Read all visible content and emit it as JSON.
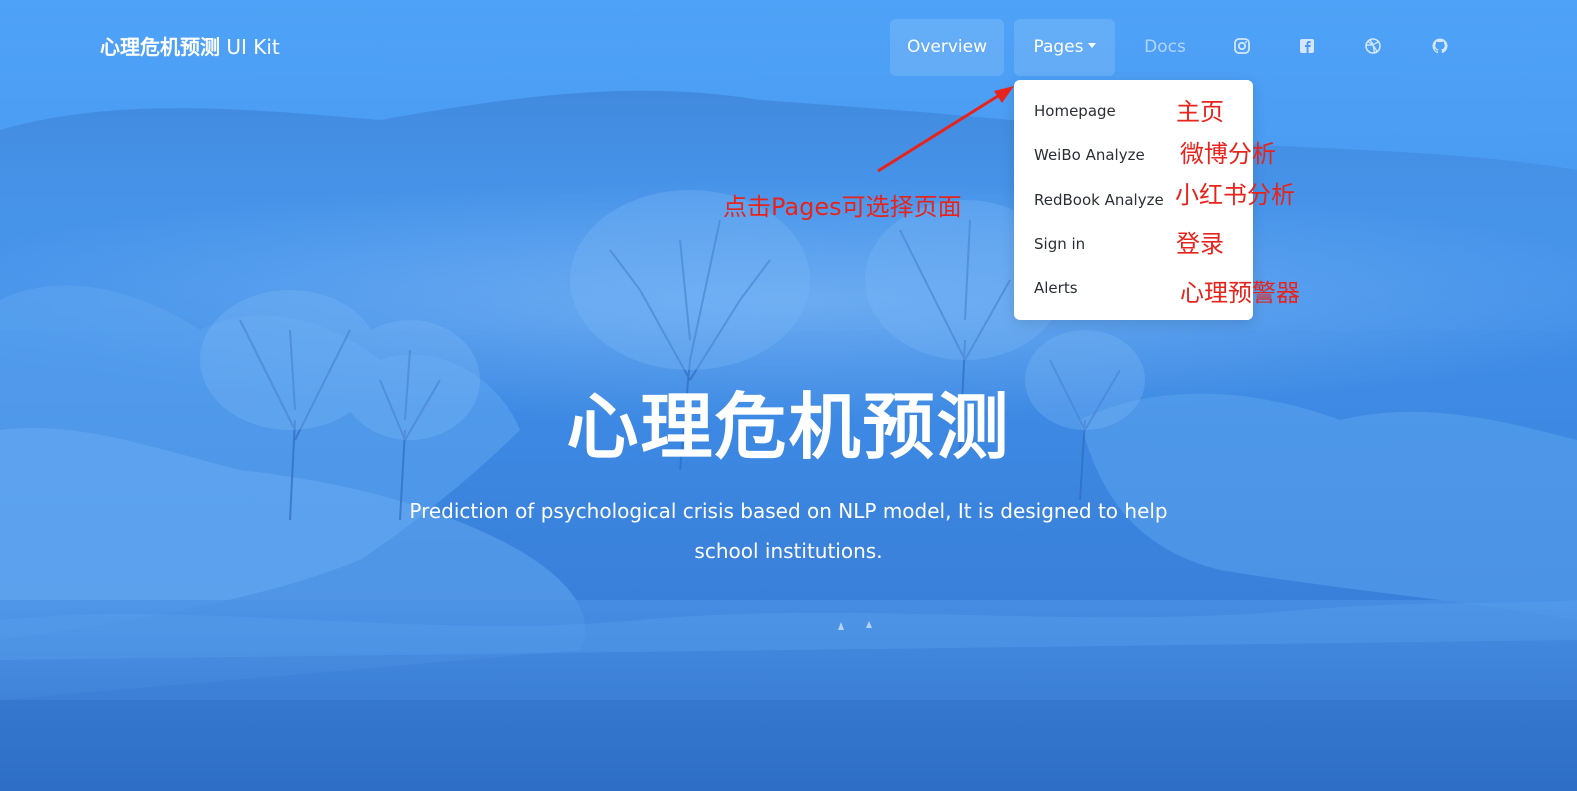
{
  "navbar": {
    "brand_cn": "心理危机预测",
    "brand_ui": " UI Kit",
    "overview_label": "Overview",
    "pages_label": "Pages",
    "docs_label": "Docs",
    "icons": [
      "instagram-icon",
      "facebook-icon",
      "dribbble-icon",
      "github-icon"
    ]
  },
  "dropdown": {
    "items": [
      {
        "label": "Homepage"
      },
      {
        "label": "WeiBo Analyze"
      },
      {
        "label": "RedBook Analyze"
      },
      {
        "label": "Sign in"
      },
      {
        "label": "Alerts"
      }
    ]
  },
  "annotations": {
    "pages_hint": "点击Pages可选择页面",
    "homepage": "主页",
    "weibo": "微博分析",
    "redbook": "小红书分析",
    "signin": "登录",
    "alerts": "心理预警器"
  },
  "hero": {
    "title": "心理危机预测",
    "subtitle_line1": "Prediction of psychological crisis based on NLP model, It is designed to help",
    "subtitle_line2": "school institutions."
  },
  "colors": {
    "background": "#4a9cf2",
    "annotation": "#e8231c",
    "dropdown_bg": "#ffffff"
  }
}
